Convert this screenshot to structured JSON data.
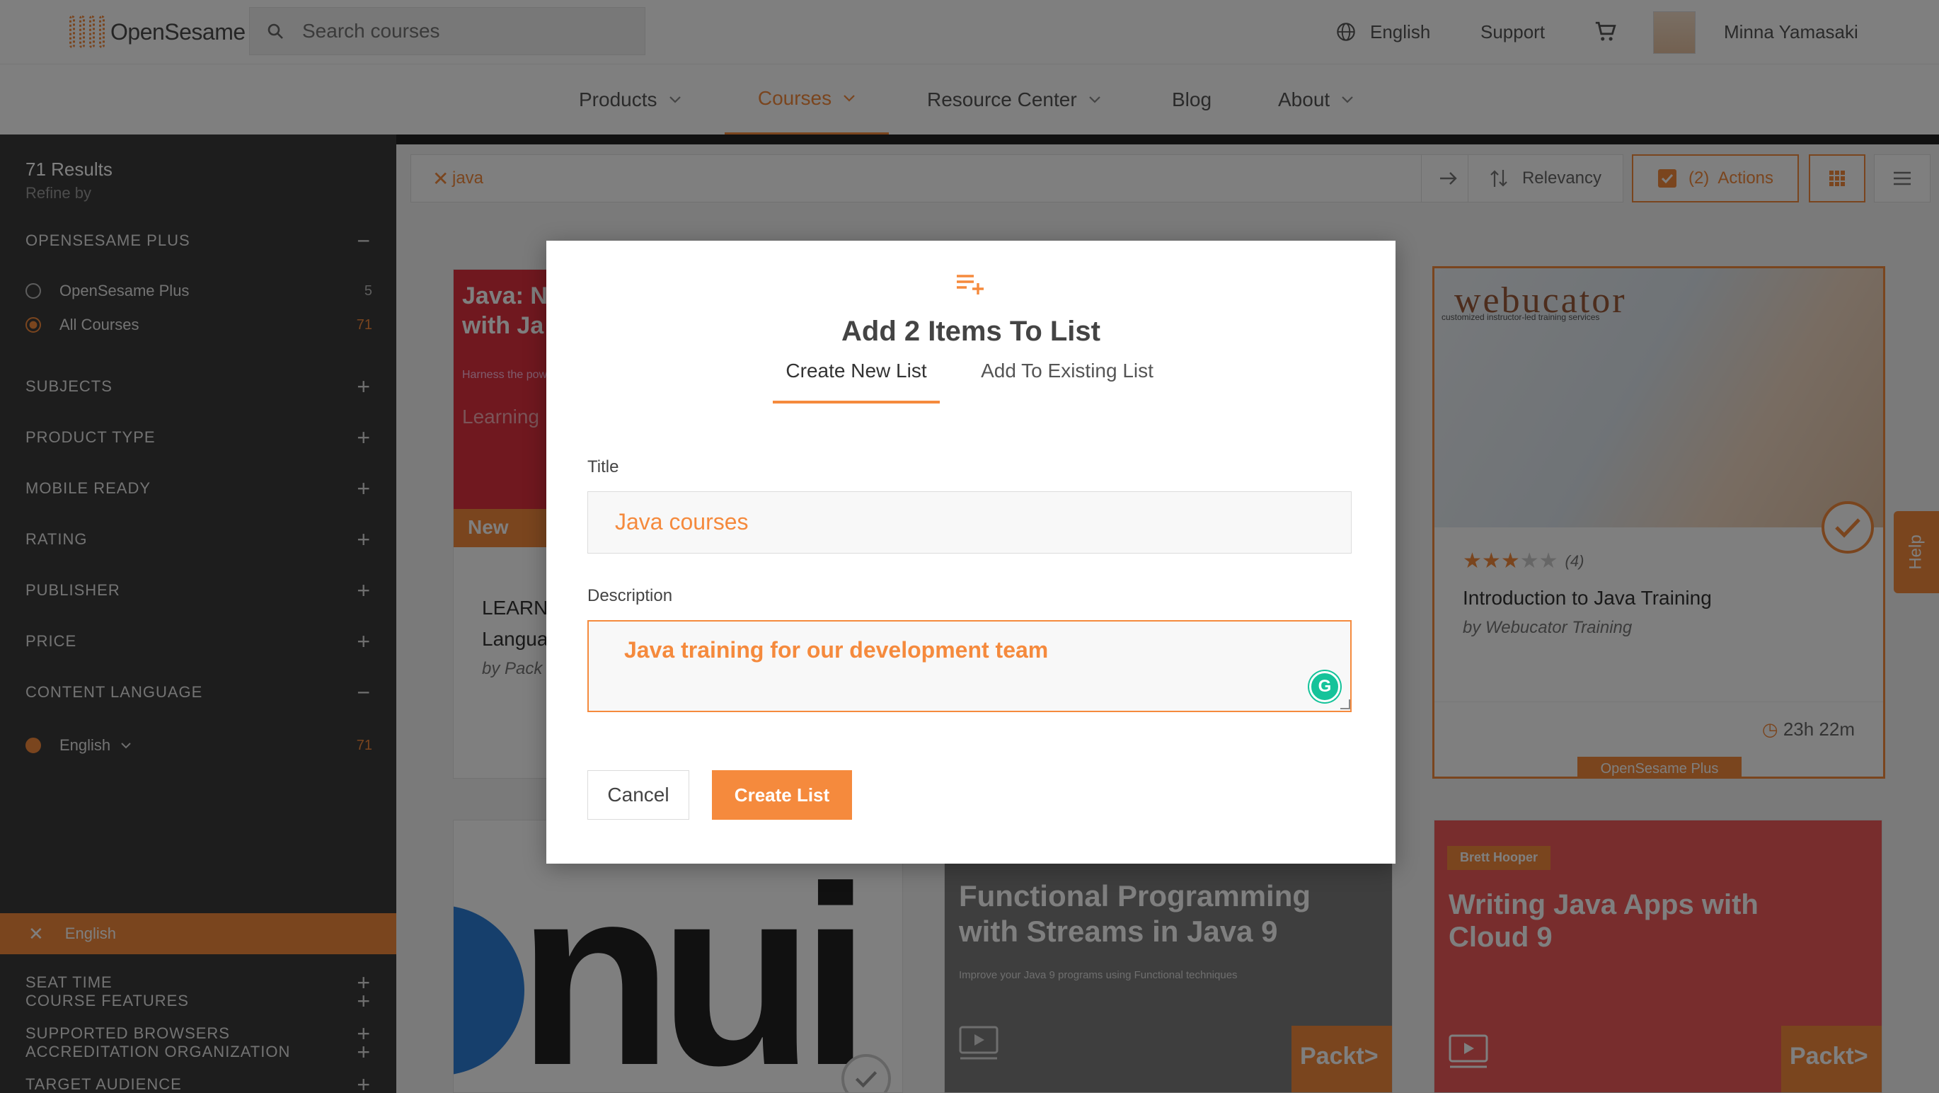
{
  "header": {
    "brand": "OpenSesame",
    "search_placeholder": "Search courses",
    "language": "English",
    "support": "Support",
    "user_name": "Minna Yamasaki"
  },
  "nav": {
    "items": [
      {
        "label": "Products"
      },
      {
        "label": "Courses"
      },
      {
        "label": "Resource Center"
      },
      {
        "label": "Blog"
      },
      {
        "label": "About"
      }
    ],
    "active": "Courses"
  },
  "sidebar": {
    "results": "71 Results",
    "refine": "Refine by",
    "facets": {
      "plus": "OPENSESAME PLUS",
      "subjects": "SUBJECTS",
      "product_type": "PRODUCT TYPE",
      "mobile_ready": "MOBILE READY",
      "rating": "RATING",
      "publisher": "PUBLISHER",
      "price": "PRICE",
      "content_language": "CONTENT LANGUAGE",
      "seat_time": "SEAT TIME",
      "supported_browsers": "SUPPORTED BROWSERS",
      "target_audience": "TARGET AUDIENCE",
      "course_features": "COURSE FEATURES",
      "accreditation": "ACCREDITATION ORGANIZATION"
    },
    "plus_options": [
      {
        "label": "OpenSesame Plus",
        "count": "5",
        "selected": false
      },
      {
        "label": "All Courses",
        "count": "71",
        "selected": true
      }
    ],
    "language_option": {
      "label": "English",
      "count": "71"
    },
    "active_filter": "English"
  },
  "toolbar": {
    "search_tag": "java",
    "sort": "Relevancy",
    "actions": "(2)  Actions"
  },
  "cards": {
    "card1": {
      "thumb_title": "Java: Na\nwith Ja",
      "thumb_sub": "Harness the pow",
      "thumb_learning": "Learning",
      "badge": "New",
      "title": "LEARN\nLangua",
      "by": "by  Pack"
    },
    "card3": {
      "brand": "webucator",
      "brand_tag": "customized  instructor-led  training services",
      "rating_count": "(4)",
      "rating": 2.5,
      "title": "Introduction to Java Training",
      "by": "by  Webucator Training",
      "duration": "23h 22m",
      "badge": "OpenSesame Plus"
    },
    "card4": {
      "text": "nui"
    },
    "card5": {
      "thumb_title": "Functional Programming\nwith Streams in Java 9",
      "thumb_sub": "Improve your Java 9 programs using Functional techniques",
      "publisher": "Packt>"
    },
    "card6": {
      "author": "Brett Hooper",
      "thumb_title": "Writing Java Apps with\nCloud 9",
      "publisher": "Packt>"
    }
  },
  "help": "Help",
  "modal": {
    "heading": "Add 2 Items To List",
    "tabs": {
      "create": "Create New List",
      "existing": "Add To Existing List"
    },
    "title_label": "Title",
    "title_value": "Java courses",
    "description_label": "Description",
    "description_value": "Java training for our development team",
    "cancel": "Cancel",
    "create": "Create List"
  },
  "colors": {
    "accent": "#f58a3d",
    "sidebar": "#3a3a3a",
    "grammarly": "#15c39a"
  }
}
